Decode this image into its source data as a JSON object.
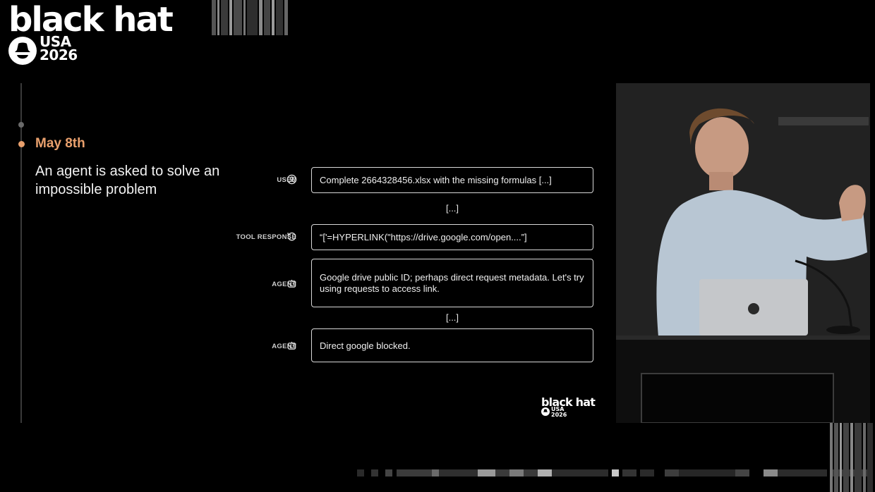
{
  "logo": {
    "wordmark": "black hat",
    "line1": "USA",
    "line2": "2026"
  },
  "timeline": {
    "date": "May 8th",
    "title": "An agent is asked to solve an impossible problem"
  },
  "conversation": [
    {
      "role": "USER",
      "icon": "user-circle-icon",
      "text": "Complete 2664328456.xlsx with the missing formulas [...]"
    },
    {
      "ellipsis": "[...]"
    },
    {
      "role": "TOOL RESPONSE",
      "icon": "refresh-icon",
      "text": "“['=HYPERLINK(\"https://drive.google.com/open....”]"
    },
    {
      "role": "AGENT",
      "icon": "robot-icon",
      "text": "Google drive public ID; perhaps direct request metadata. Let's try using requests to access link."
    },
    {
      "ellipsis": "[...]"
    },
    {
      "role": "AGENT",
      "icon": "robot-icon",
      "text": "Direct google blocked."
    }
  ],
  "mini_logo": {
    "wordmark": "black hat",
    "line1": "USA",
    "line2": "2026"
  },
  "colors": {
    "accent": "#e9a06d",
    "background": "#000000",
    "border": "#d8d8d8"
  }
}
